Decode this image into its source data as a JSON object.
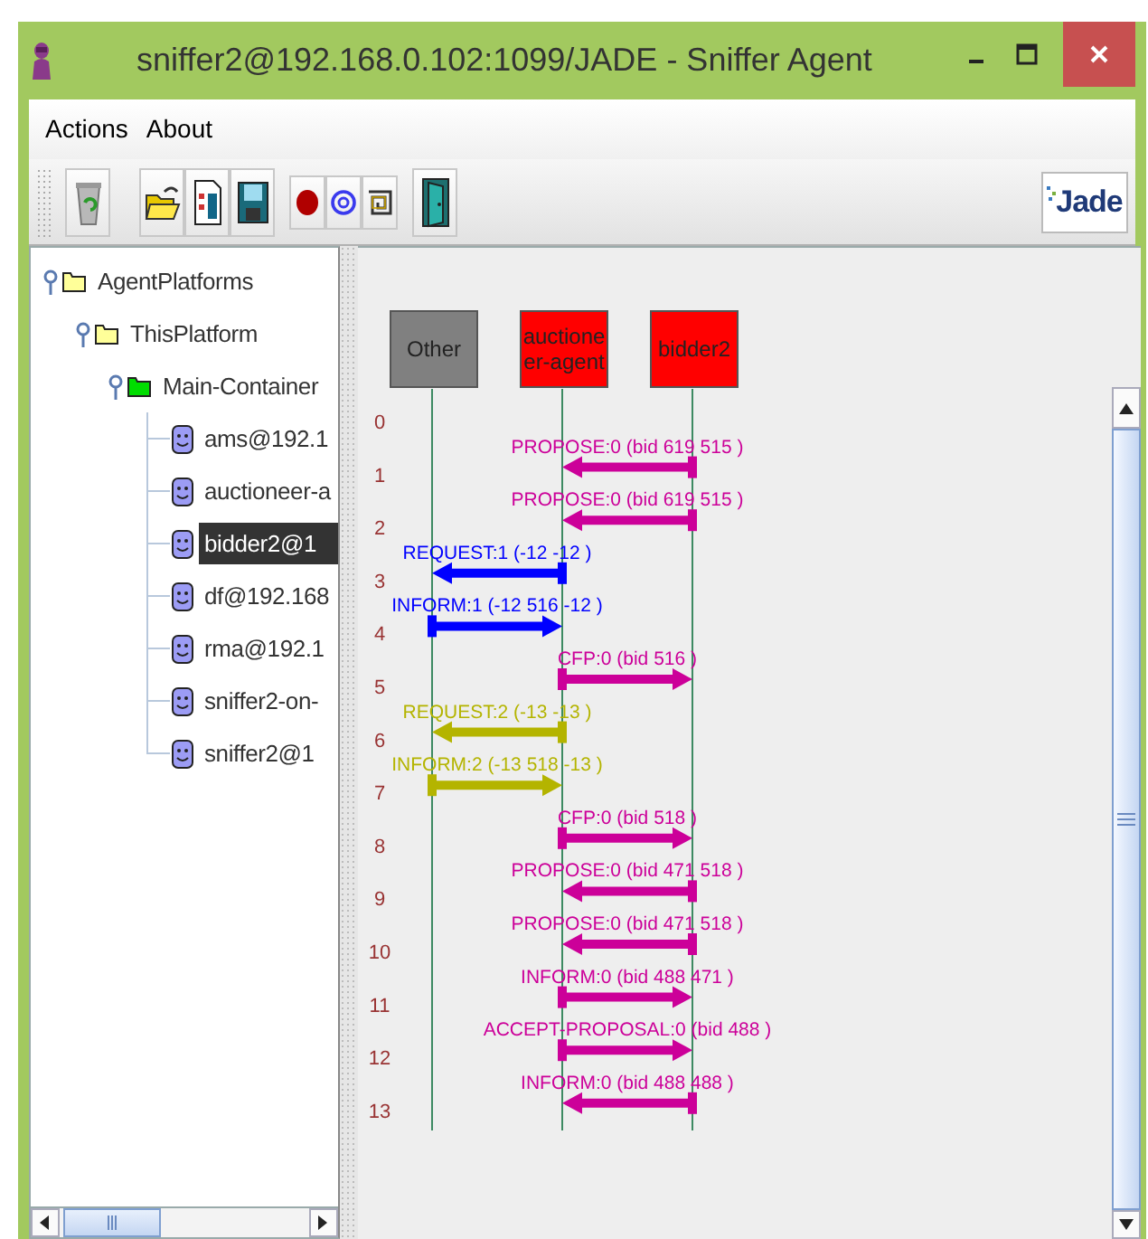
{
  "window": {
    "title": "sniffer2@192.168.0.102:1099/JADE - Sniffer Agent"
  },
  "menu": [
    "Actions",
    "About"
  ],
  "toolbar": {
    "groups": [
      [
        {
          "kind": "trash"
        }
      ],
      [
        {
          "kind": "open"
        },
        {
          "kind": "document"
        },
        {
          "kind": "save"
        }
      ],
      [
        {
          "kind": "record"
        },
        {
          "kind": "spiral"
        },
        {
          "kind": "square-spiral"
        }
      ],
      [
        {
          "kind": "door"
        }
      ]
    ],
    "logo": "Jade"
  },
  "tree": [
    {
      "label": "AgentPlatforms",
      "kind": "folder",
      "expanded": true,
      "selected": false,
      "children": [
        {
          "label": "ThisPlatform",
          "kind": "folder",
          "expanded": true,
          "selected": false,
          "children": [
            {
              "label": "Main-Container",
              "kind": "container",
              "expanded": true,
              "selected": false,
              "children": [
                {
                  "label": "ams@192.1",
                  "kind": "agent",
                  "selected": false
                },
                {
                  "label": "auctioneer-a",
                  "kind": "agent",
                  "selected": false
                },
                {
                  "label": "bidder2@1",
                  "kind": "agent",
                  "selected": true
                },
                {
                  "label": "df@192.168",
                  "kind": "agent",
                  "selected": false
                },
                {
                  "label": "rma@192.1",
                  "kind": "agent",
                  "selected": false
                },
                {
                  "label": "sniffer2-on-",
                  "kind": "agent",
                  "selected": false
                },
                {
                  "label": "sniffer2@1",
                  "kind": "agent",
                  "selected": false
                }
              ]
            }
          ]
        }
      ]
    }
  ],
  "diagram": {
    "agents": [
      {
        "name": "Other",
        "color": "#808080"
      },
      {
        "name": "auctioneer-agent",
        "color": "#ff0000"
      },
      {
        "name": "bidder2",
        "color": "#ff0000"
      }
    ],
    "rows": [
      {
        "number": "0"
      },
      {
        "number": "1",
        "message": {
          "label": "PROPOSE:0 (bid 619 515 )",
          "kind": "bidder-to-auctioneer",
          "color": "#cc0099"
        }
      },
      {
        "number": "2",
        "message": {
          "label": "PROPOSE:0 (bid 619 515 )",
          "kind": "bidder-to-auctioneer",
          "color": "#cc0099"
        }
      },
      {
        "number": "3",
        "message": {
          "label": "REQUEST:1 (-12 -12 )",
          "kind": "auctioneer-to-other",
          "color": "#0000ff"
        }
      },
      {
        "number": "4",
        "message": {
          "label": "INFORM:1 (-12 516 -12 )",
          "kind": "other-to-auctioneer",
          "color": "#0000ff"
        }
      },
      {
        "number": "5",
        "message": {
          "label": "CFP:0 (bid 516 )",
          "kind": "auctioneer-to-bidder",
          "color": "#cc0099"
        }
      },
      {
        "number": "6",
        "message": {
          "label": "REQUEST:2 (-13 -13 )",
          "kind": "auctioneer-to-other",
          "color": "#b4b400"
        }
      },
      {
        "number": "7",
        "message": {
          "label": "INFORM:2 (-13 518 -13 )",
          "kind": "other-to-auctioneer",
          "color": "#b4b400"
        }
      },
      {
        "number": "8",
        "message": {
          "label": "CFP:0 (bid 518 )",
          "kind": "auctioneer-to-bidder",
          "color": "#cc0099"
        }
      },
      {
        "number": "9",
        "message": {
          "label": "PROPOSE:0 (bid 471 518 )",
          "kind": "bidder-to-auctioneer",
          "color": "#cc0099"
        }
      },
      {
        "number": "10",
        "message": {
          "label": "PROPOSE:0 (bid 471 518 )",
          "kind": "bidder-to-auctioneer",
          "color": "#cc0099"
        }
      },
      {
        "number": "11",
        "message": {
          "label": "INFORM:0 (bid 488 471 )",
          "kind": "auctioneer-to-bidder",
          "color": "#cc0099"
        }
      },
      {
        "number": "12",
        "message": {
          "label": "ACCEPT-PROPOSAL:0 (bid 488 )",
          "kind": "auctioneer-to-bidder",
          "color": "#cc0099"
        }
      },
      {
        "number": "13",
        "message": {
          "label": "INFORM:0 (bid 488 488 )",
          "kind": "bidder-to-auctioneer",
          "color": "#cc0099"
        }
      }
    ]
  }
}
